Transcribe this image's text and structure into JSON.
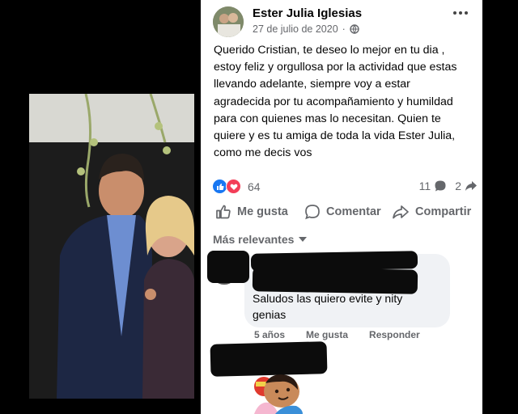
{
  "post": {
    "author": "Ester Julia Iglesias",
    "date": "27 de julio de 2020",
    "privacy_icon": "globe-icon",
    "text": "Querido Cristian, te deseo lo mejor en tu dia ,\n estoy feliz y orgullosa por la actividad que estas\nllevando adelante, siempre voy a estar\nagradecida por tu acompañamiento y humildad\npara con quienes mas lo necesitan. Quien te\nquiere y es tu amiga de toda la vida Ester Julia,\ncomo me decis vos",
    "reaction_count": "64",
    "comment_count": "11",
    "share_count": "2"
  },
  "actions": {
    "like": "Me gusta",
    "comment": "Comentar",
    "share": "Compartir"
  },
  "comments": {
    "sort_label": "Más relevantes",
    "first": {
      "text": "Saludos las quiero evite y nity genias",
      "time": "5 años",
      "like": "Me gusta",
      "reply": "Responder"
    }
  },
  "colors": {
    "like_blue": "#1877f2",
    "love_red": "#f33e58",
    "secondary_text": "#65676b",
    "bubble": "#f0f2f5"
  }
}
